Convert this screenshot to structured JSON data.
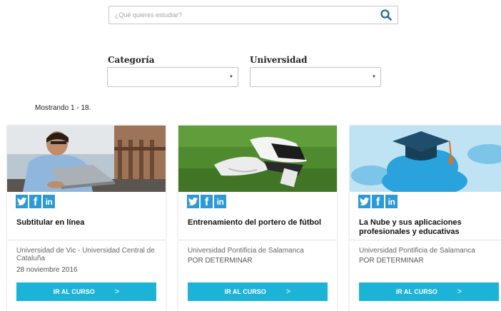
{
  "search": {
    "placeholder": "¿Qué quieres estudiar?"
  },
  "filters": {
    "category_label": "Categoría",
    "university_label": "Universidad",
    "category_value": "",
    "university_value": ""
  },
  "results": {
    "count_text": "Mostrando 1 - 18."
  },
  "colors": {
    "accent": "#1cb3d6",
    "social": "#2c9ad6"
  },
  "cards": [
    {
      "title": "Subtitular en línea",
      "university": "Universidad de Vic - Universidad Central de Cataluña",
      "date": "28 noviembre 2016",
      "button": "IR AL CURSO",
      "image": "man-with-laptop-photo"
    },
    {
      "title": "Entrenamiento del portero de fútbol",
      "university": "Universidad Pontificia de Salamanca",
      "date": "POR DETERMINAR",
      "button": "IR AL CURSO",
      "image": "goalkeeper-gloves-on-grass-photo"
    },
    {
      "title": "La Nube y sus aplicaciones profesionales y educativas",
      "university": "Universidad Pontificia de Salamanca",
      "date": "POR DETERMINAR",
      "button": "IR AL CURSO",
      "image": "graduation-cap-on-cloud-illustration"
    }
  ],
  "social_icons": [
    "twitter-icon",
    "facebook-icon",
    "linkedin-icon"
  ]
}
